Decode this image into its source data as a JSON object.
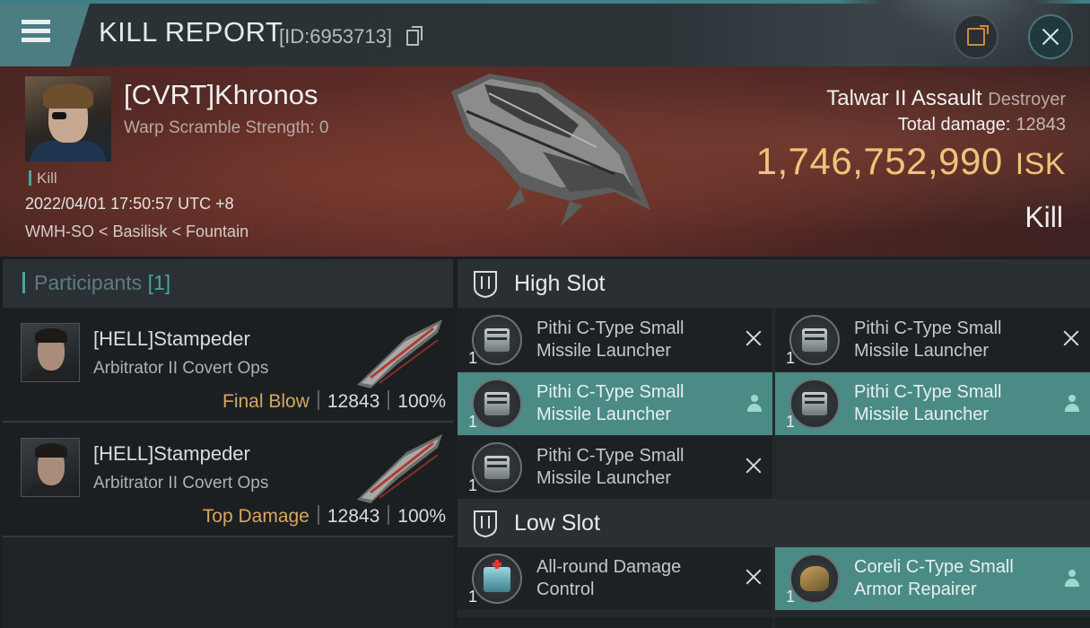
{
  "header": {
    "title": "KILL REPORT",
    "report_id": "[ID:6953713]"
  },
  "victim": {
    "name": "[CVRT]Khronos",
    "scramble": "Warp Scramble Strength: 0",
    "tag": "Kill",
    "datetime": "2022/04/01 17:50:57 UTC +8",
    "location": "WMH-SO < Basilisk < Fountain",
    "ship_name": "Talwar II Assault",
    "ship_class": "Destroyer",
    "total_damage_label": "Total damage:",
    "total_damage": "12843",
    "isk_value": "1,746,752,990",
    "isk_unit": "ISK",
    "result": "Kill"
  },
  "participants": {
    "title": "Participants",
    "count": "[1]",
    "rows": [
      {
        "name": "[HELL]Stampeder",
        "ship": "Arbitrator II Covert Ops",
        "label": "Final Blow",
        "damage": "12843",
        "percent": "100%"
      },
      {
        "name": "[HELL]Stampeder",
        "ship": "Arbitrator II Covert Ops",
        "label": "Top Damage",
        "damage": "12843",
        "percent": "100%"
      }
    ]
  },
  "fitting": {
    "high_slot_title": "High Slot",
    "low_slot_title": "Low Slot",
    "high": [
      {
        "qty": "1",
        "name": "Pithi C-Type Small Missile Launcher",
        "status": "destroyed"
      },
      {
        "qty": "1",
        "name": "Pithi C-Type Small Missile Launcher",
        "status": "destroyed"
      },
      {
        "qty": "1",
        "name": "Pithi C-Type Small Missile Launcher",
        "status": "dropped"
      },
      {
        "qty": "1",
        "name": "Pithi C-Type Small Missile Launcher",
        "status": "dropped"
      },
      {
        "qty": "1",
        "name": "Pithi C-Type Small Missile Launcher",
        "status": "destroyed"
      }
    ],
    "low": [
      {
        "qty": "1",
        "name": "All-round Damage Control",
        "status": "destroyed"
      },
      {
        "qty": "1",
        "name": "Coreli C-Type Small Armor Repairer",
        "status": "dropped"
      }
    ]
  },
  "colors": {
    "accent": "#4aa59a",
    "isk": "#f1c27a",
    "label_gold": "#d6a760",
    "dropped_row": "#4b8b86"
  }
}
